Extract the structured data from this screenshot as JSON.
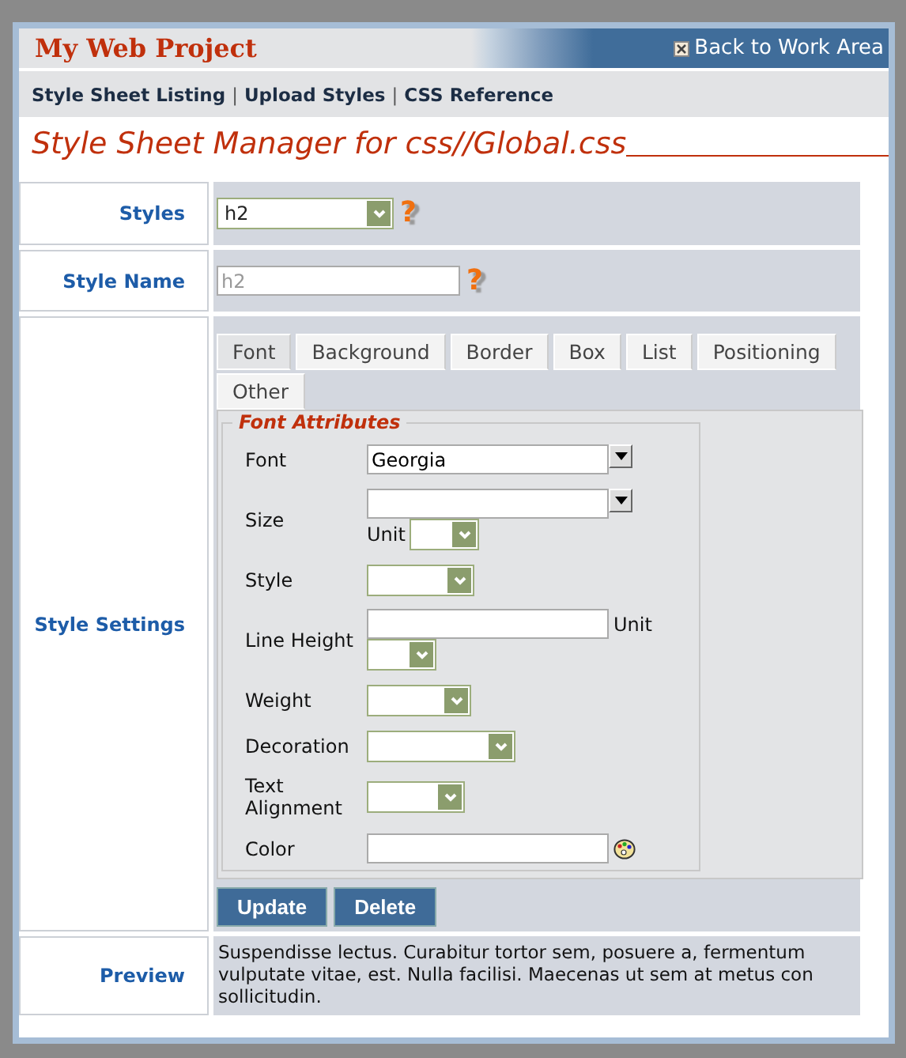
{
  "window": {
    "title": "My Web Project",
    "back_link": "Back to Work Area"
  },
  "nav": [
    "Style Sheet Listing",
    "Upload Styles",
    "CSS Reference"
  ],
  "nav_separator": "|",
  "heading": "Style Sheet Manager for css//Global.css",
  "styles_row": {
    "label": "Styles",
    "value": "h2",
    "help": "?"
  },
  "style_name_row": {
    "label": "Style Name",
    "placeholder": "h2",
    "help": "?"
  },
  "settings": {
    "label": "Style Settings",
    "tabs": [
      {
        "label": "Font",
        "selected": true
      },
      {
        "label": "Background",
        "selected": false
      },
      {
        "label": "Border",
        "selected": false
      },
      {
        "label": "Box",
        "selected": false
      },
      {
        "label": "List",
        "selected": false
      },
      {
        "label": "Positioning",
        "selected": false
      },
      {
        "label": "Other",
        "selected": false
      }
    ],
    "fieldset_title": "Font Attributes",
    "fields": [
      {
        "label": "Font",
        "kind": "combo",
        "value": "Georgia"
      },
      {
        "label": "Size",
        "kind": "combo",
        "unit_label": "Unit"
      },
      {
        "label": "Style",
        "kind": "select"
      },
      {
        "label": "Line Height",
        "kind": "text",
        "unit_label": "Unit"
      },
      {
        "label": "Weight",
        "kind": "select"
      },
      {
        "label": "Decoration",
        "kind": "select"
      },
      {
        "label": "Text Alignment",
        "kind": "select"
      },
      {
        "label": "Color",
        "kind": "color"
      }
    ],
    "buttons": [
      "Update",
      "Delete"
    ]
  },
  "preview": {
    "label": "Preview",
    "lines": [
      "Suspendisse lectus. Curabitur tortor sem, posuere a, fermentum",
      "vulputate vitae, est. Nulla facilisi. Maecenas ut sem at metus con",
      "sollicitudin."
    ]
  }
}
